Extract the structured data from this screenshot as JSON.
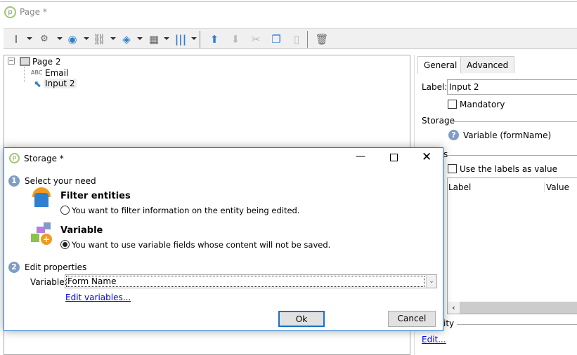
{
  "window": {
    "title": "Page *"
  },
  "toolbar": {
    "icons": [
      "text-cursor-icon",
      "input-settings-icon",
      "globe-icon",
      "link-icon",
      "layers-icon",
      "table-icon",
      "columns-icon",
      "move-up-icon",
      "move-down-icon",
      "cut-icon",
      "copy-icon",
      "paste-icon",
      "delete-icon"
    ]
  },
  "tree": {
    "root": "Page 2",
    "children": [
      {
        "icon": "ABC",
        "label": "Email"
      },
      {
        "label": "Input 2"
      }
    ]
  },
  "properties": {
    "tabs": [
      "General",
      "Advanced"
    ],
    "label_caption": "Label:",
    "label_value": "Input 2",
    "mandatory": "Mandatory",
    "mandatory_checked": false,
    "storage_group": "Storage",
    "storage_value": "Variable (formName)",
    "values_group_fragment": "s",
    "use_labels": "Use the labels as value",
    "use_labels_checked": false,
    "columns": [
      "Label",
      "Value"
    ],
    "visibility_group_fragment": "ity",
    "edit_link": "Edit..."
  },
  "dialog": {
    "title": "Storage *",
    "step1_num": "1",
    "step1": "Select your need",
    "option1_title": "Filter entities",
    "option1_desc": "You want to filter information on the entity being edited.",
    "option1_selected": false,
    "option2_title": "Variable",
    "option2_desc": "You want to use variable fields whose content will not be saved.",
    "option2_selected": true,
    "step2_num": "2",
    "step2": "Edit properties",
    "variable_label": "Variable:",
    "variable_value": "Form Name",
    "edit_variables": "Edit variables...",
    "ok": "Ok",
    "cancel": "Cancel"
  },
  "colors": {
    "accent": "#1a73c6",
    "toolbar_blue": "#2f7fd0",
    "step_badge": "#7f9cc8"
  }
}
